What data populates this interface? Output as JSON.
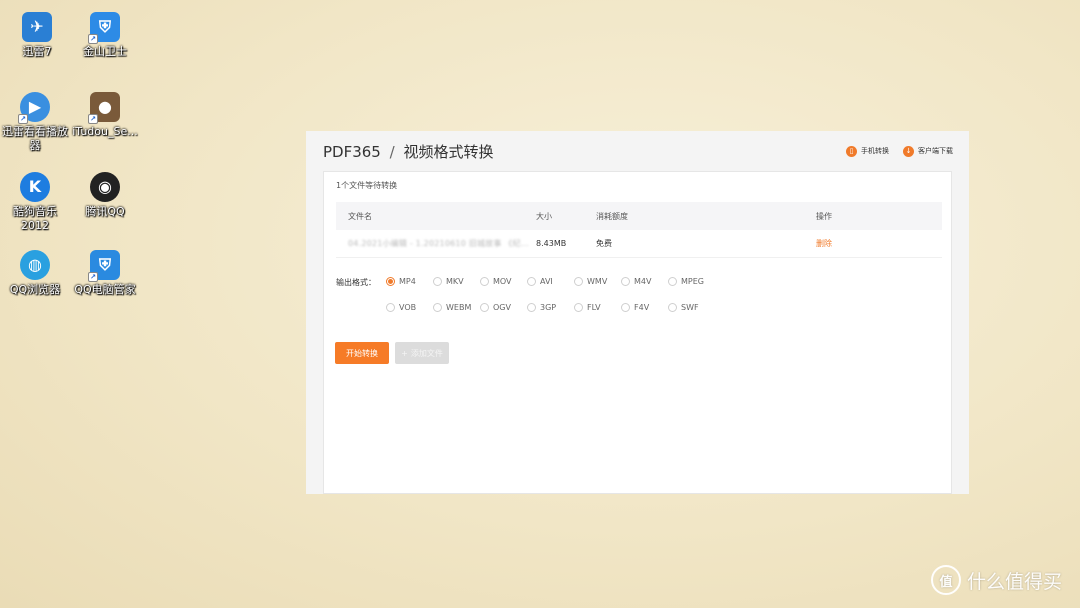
{
  "desktop": {
    "icons": [
      {
        "label": "迅雷7",
        "glyph": "✈",
        "color": "#2a7fd4"
      },
      {
        "label": "金山卫士",
        "glyph": "⛨",
        "color": "#2d8be6"
      },
      {
        "label": "迅雷看看播放器",
        "glyph": "▶",
        "color": "#3a8fe0"
      },
      {
        "label": "iTudou_Se...",
        "glyph": "●",
        "color": "#7a5a3a"
      },
      {
        "label": "酷狗音乐2012",
        "glyph": "K",
        "color": "#1e7de0"
      },
      {
        "label": "腾讯QQ",
        "glyph": "◉",
        "color": "#222222"
      },
      {
        "label": "QQ浏览器",
        "glyph": "◍",
        "color": "#2aa0e0"
      },
      {
        "label": "QQ电脑管家",
        "glyph": "⛨",
        "color": "#2a8ae0"
      }
    ]
  },
  "app": {
    "brand": "PDF365",
    "separator": "/",
    "title": "视频格式转换",
    "header_links": {
      "mobile": "手机转换",
      "client_download": "客户端下载"
    },
    "pending_text": "1个文件等待转换",
    "table": {
      "headers": {
        "name": "文件名",
        "size": "大小",
        "quota": "消耗额度",
        "action": "操作"
      },
      "rows": [
        {
          "name": "04.2021小编辑 - 1.20210610 旧城故事 《纪念日的...",
          "size": "8.43MB",
          "quota": "免费",
          "action": "删除"
        }
      ]
    },
    "output_label": "输出格式：",
    "formats": [
      "MP4",
      "MKV",
      "MOV",
      "AVI",
      "WMV",
      "M4V",
      "MPEG",
      "VOB",
      "WEBM",
      "OGV",
      "3GP",
      "FLV",
      "F4V",
      "SWF"
    ],
    "selected_format": "MP4",
    "start_button": "开始转换",
    "add_button": "添加文件",
    "accent_color": "#f67b27"
  },
  "watermark": {
    "logo": "值",
    "text": "什么值得买"
  }
}
